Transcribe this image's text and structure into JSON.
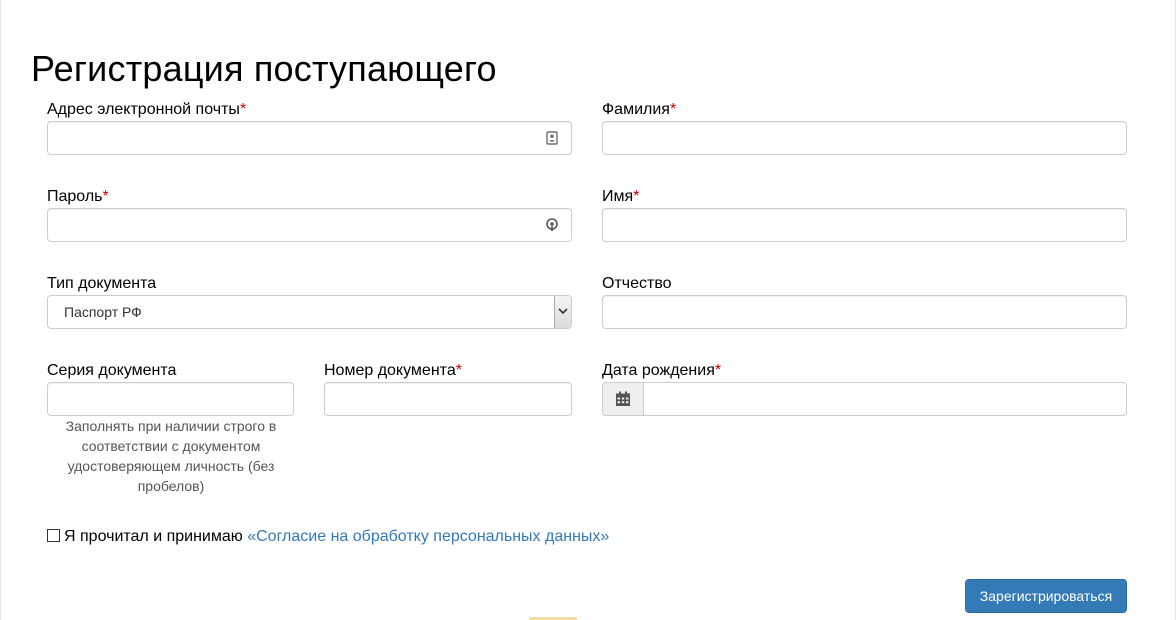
{
  "page": {
    "title": "Регистрация поступающего"
  },
  "form": {
    "email": {
      "label": "Адрес электронной почты",
      "required_mark": "*",
      "value": "",
      "icon": "contact-card-icon"
    },
    "password": {
      "label": "Пароль",
      "required_mark": "*",
      "value": "",
      "icon": "key-icon"
    },
    "doc_type": {
      "label": "Тип документа",
      "selected": "Паспорт РФ"
    },
    "doc_series": {
      "label": "Серия документа",
      "value": "",
      "help": "Заполнять при наличии строго в соответствии с документом удостоверяющем личность (без пробелов)"
    },
    "doc_number": {
      "label": "Номер документа",
      "required_mark": "*",
      "value": ""
    },
    "last_name": {
      "label": "Фамилия",
      "required_mark": "*",
      "value": ""
    },
    "first_name": {
      "label": "Имя",
      "required_mark": "*",
      "value": ""
    },
    "middle_name": {
      "label": "Отчество",
      "value": ""
    },
    "birth_date": {
      "label": "Дата рождения",
      "required_mark": "*",
      "value": "",
      "icon": "calendar-icon"
    }
  },
  "agreement": {
    "text": "Я прочитал и принимаю",
    "link": "«Согласие на обработку персональных данных»",
    "checked": false
  },
  "actions": {
    "submit_label": "Зарегистрироваться"
  },
  "colors": {
    "primary": "#337ab7",
    "required": "#cc0000",
    "link": "#337ab7"
  }
}
